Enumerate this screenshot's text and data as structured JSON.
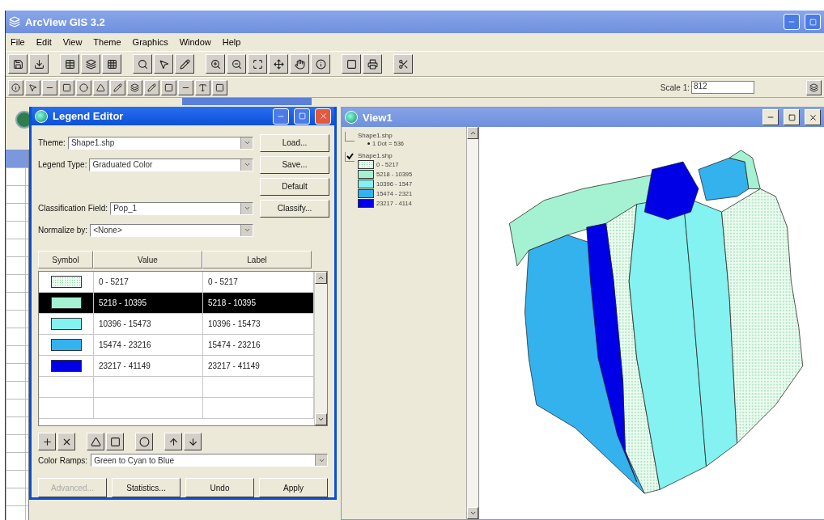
{
  "app": {
    "title": "ArcView GIS 3.2",
    "menu": [
      "File",
      "Edit",
      "View",
      "Theme",
      "Graphics",
      "Window",
      "Help"
    ],
    "scale": {
      "label": "Scale 1:",
      "value": "812"
    }
  },
  "legend_editor": {
    "title": "Legend Editor",
    "fields": [
      {
        "label": "Theme:",
        "value": "Shape1.shp"
      },
      {
        "label": "Legend Type:",
        "value": "Graduated Color"
      },
      {
        "label": "Classification Field:",
        "value": "Pop_1"
      },
      {
        "label": "Normalize by:",
        "value": "<None>"
      }
    ],
    "side_buttons": [
      "Load...",
      "Save...",
      "Default",
      "Classify..."
    ],
    "table": {
      "columns": [
        "Symbol",
        "Value",
        "Label"
      ],
      "rows": [
        {
          "kind": "dotted",
          "color": "#eafcf0",
          "value": "0 - 5217",
          "label": "0 - 5217",
          "selected": false
        },
        {
          "kind": "solid",
          "color": "#a4f2d2",
          "value": "5218 - 10395",
          "label": "5218 - 10395",
          "selected": true
        },
        {
          "kind": "solid",
          "color": "#84f2f0",
          "value": "10396 - 15473",
          "label": "10396 - 15473",
          "selected": false
        },
        {
          "kind": "solid",
          "color": "#34b2ee",
          "value": "15474 - 23216",
          "label": "15474 - 23216",
          "selected": false
        },
        {
          "kind": "solid",
          "color": "#0000e6",
          "value": "23217 - 41149",
          "label": "23217 - 41149",
          "selected": false
        }
      ]
    },
    "color_ramp": {
      "label": "Color Ramps:",
      "value": "Green to Cyan to Blue"
    },
    "bottom_buttons": [
      {
        "label": "Advanced...",
        "disabled": true
      },
      {
        "label": "Statistics...",
        "disabled": false
      },
      {
        "label": "Undo",
        "disabled": false
      },
      {
        "label": "Apply",
        "disabled": false
      }
    ]
  },
  "view": {
    "title": "View1",
    "themes": [
      {
        "name": "Shape1.shp",
        "checked": false,
        "kind": "dots",
        "entries": [
          {
            "label": "1 Dot = 536"
          }
        ]
      },
      {
        "name": "Shape1.shp",
        "checked": true,
        "kind": "classes",
        "entries": [
          {
            "label": "0 - 5217",
            "color": "#eafcf0"
          },
          {
            "label": "5218 - 10395",
            "color": "#a4f2d2"
          },
          {
            "label": "10396 - 1547",
            "color": "#84f2f0"
          },
          {
            "label": "15474 - 2321",
            "color": "#34b2ee"
          },
          {
            "label": "23217 - 4114",
            "color": "#0000e6"
          }
        ]
      }
    ]
  }
}
